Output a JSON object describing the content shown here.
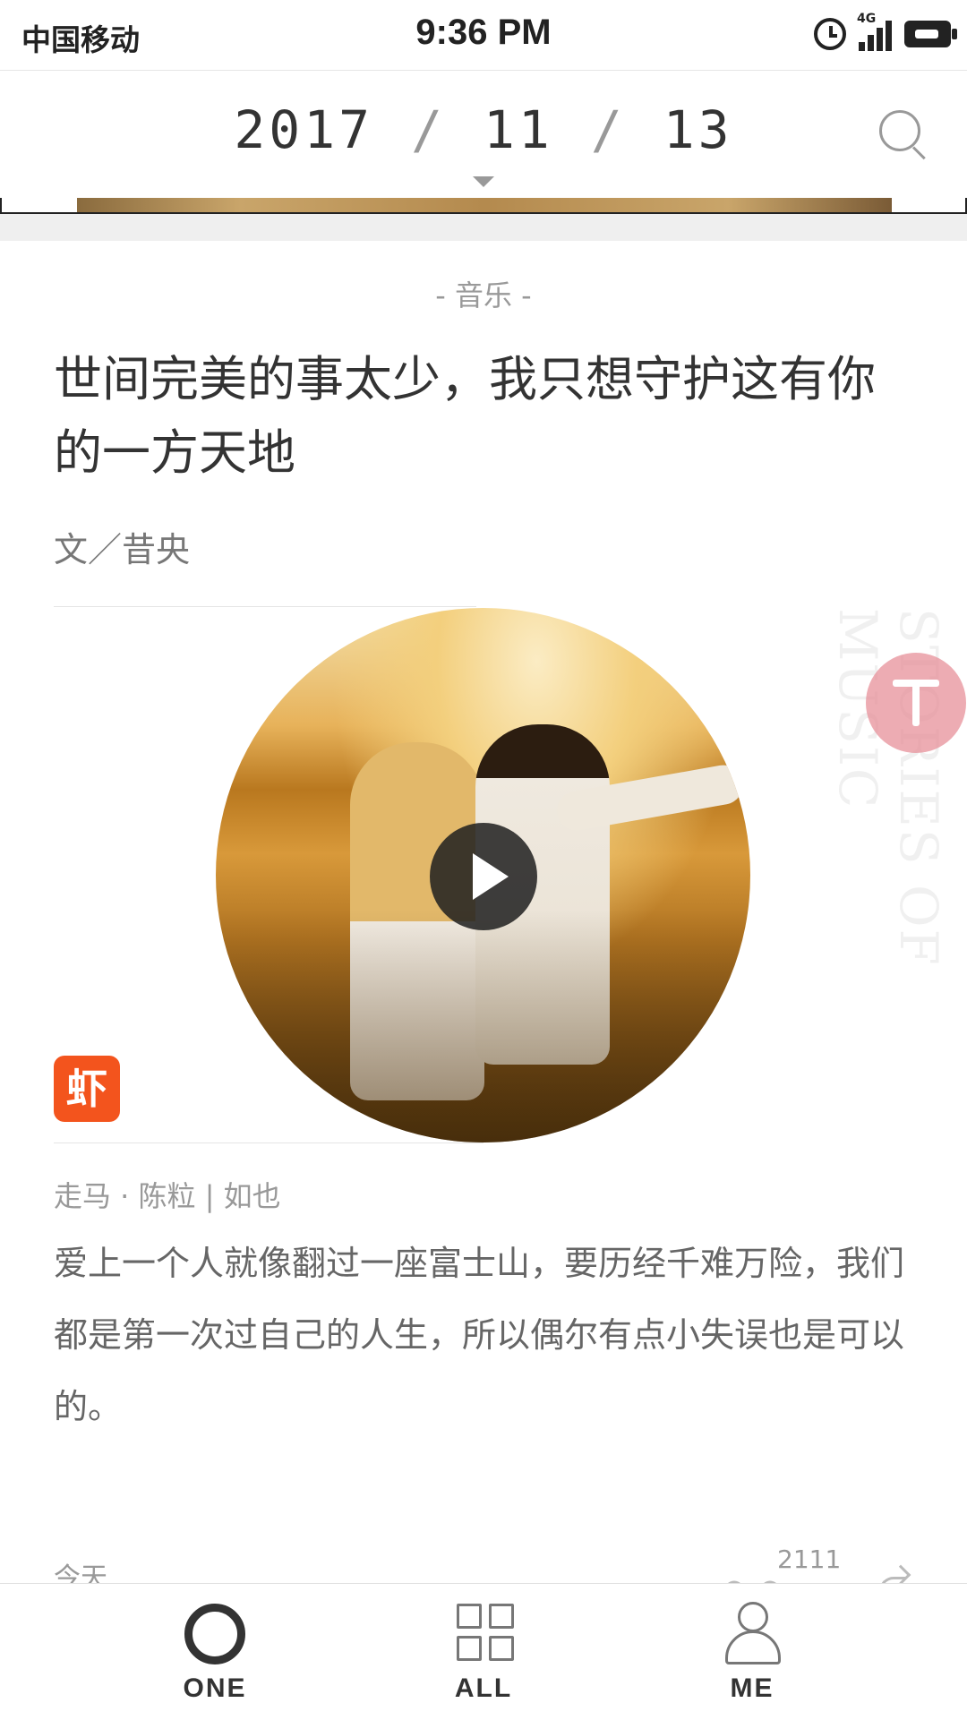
{
  "status_bar": {
    "carrier": "中国移动",
    "time": "9:36 PM",
    "network": "4G"
  },
  "date_header": {
    "year": "2017",
    "month": "11",
    "day": "13",
    "separator": "/"
  },
  "article": {
    "category": "- 音乐 -",
    "title": "世间完美的事太少，我只想守护这有你的一方天地",
    "author": "文／昔央",
    "decor_text": "STORIES OF MUSIC",
    "platform_badge": "虾",
    "song": "走马 · 陈粒 | 如也",
    "excerpt": "爱上一个人就像翻过一座富士山，要历经千难万险，我们都是第一次过自己的人生，所以偶尔有点小失误也是可以的。",
    "date_label": "今天",
    "like_count": "2111"
  },
  "bottom_nav": {
    "items": [
      {
        "label": "ONE"
      },
      {
        "label": "ALL"
      },
      {
        "label": "ME"
      }
    ]
  },
  "colors": {
    "accent_pink": "#e68c96",
    "xiami_orange": "#f3541d",
    "text_dark": "#333333",
    "text_muted": "#999999"
  },
  "icons": [
    "alarm-icon",
    "signal-icon",
    "battery-icon",
    "search-icon",
    "play-icon",
    "scroll-top-icon",
    "like-icon",
    "share-icon",
    "one-icon",
    "all-icon",
    "me-icon"
  ]
}
